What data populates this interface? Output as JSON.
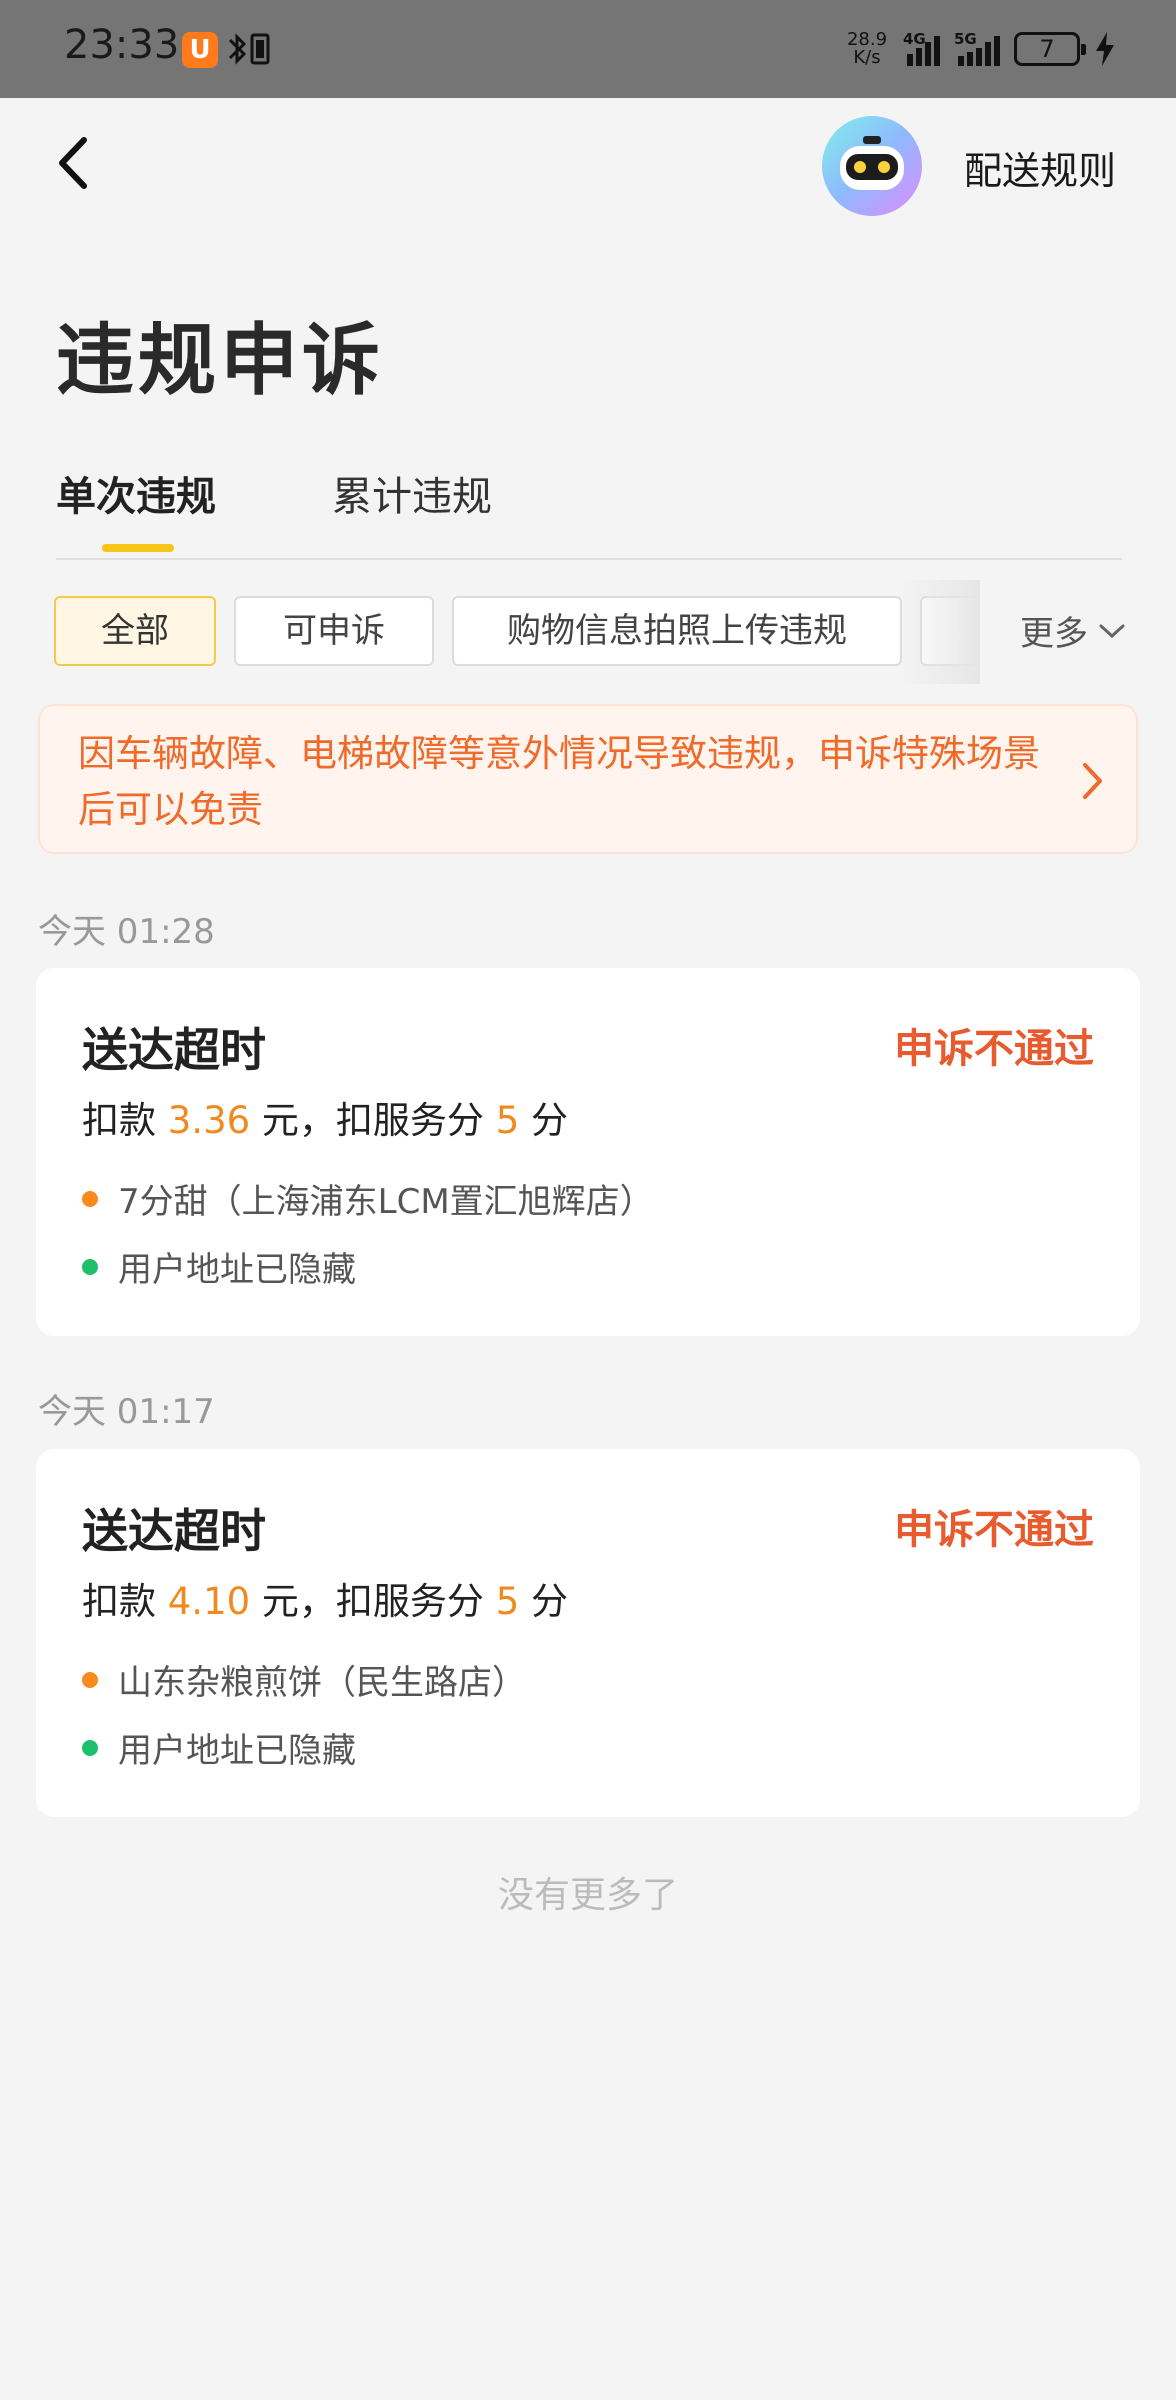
{
  "status_bar": {
    "time": "23:33",
    "app_badge": "U",
    "net_speed_value": "28.9",
    "net_speed_unit": "K/s",
    "signal_1": "4G",
    "signal_2": "5G",
    "battery": "7"
  },
  "header": {
    "rules_label": "配送规则"
  },
  "page_title": "违规申诉",
  "tabs": [
    {
      "label": "单次违规",
      "active": true
    },
    {
      "label": "累计违规",
      "active": false
    }
  ],
  "filters": {
    "chips": [
      {
        "label": "全部",
        "active": true
      },
      {
        "label": "可申诉",
        "active": false
      },
      {
        "label": "购物信息拍照上传违规",
        "active": false
      }
    ],
    "more_label": "更多"
  },
  "notice": {
    "text": "因车辆故障、电梯故障等意外情况导致违规，申诉特殊场景后可以免责"
  },
  "records": [
    {
      "date": "今天 01:28",
      "title": "送达超时",
      "status": "申诉不通过",
      "penalty_prefix": "扣款 ",
      "amount": "3.36",
      "penalty_mid": " 元，扣服务分 ",
      "points": "5",
      "penalty_suffix": " 分",
      "store": "7分甜（上海浦东LCM置汇旭辉店）",
      "address": "用户地址已隐藏"
    },
    {
      "date": "今天 01:17",
      "title": "送达超时",
      "status": "申诉不通过",
      "penalty_prefix": "扣款 ",
      "amount": "4.10",
      "penalty_mid": " 元，扣服务分 ",
      "points": "5",
      "penalty_suffix": " 分",
      "store": "山东杂粮煎饼（民生路店）",
      "address": "用户地址已隐藏"
    }
  ],
  "footer": {
    "no_more": "没有更多了"
  },
  "colors": {
    "accent_yellow": "#f5c518",
    "status_red": "#e85b2e",
    "amount_orange": "#f08a1e",
    "notice_orange": "#f06a2a"
  }
}
